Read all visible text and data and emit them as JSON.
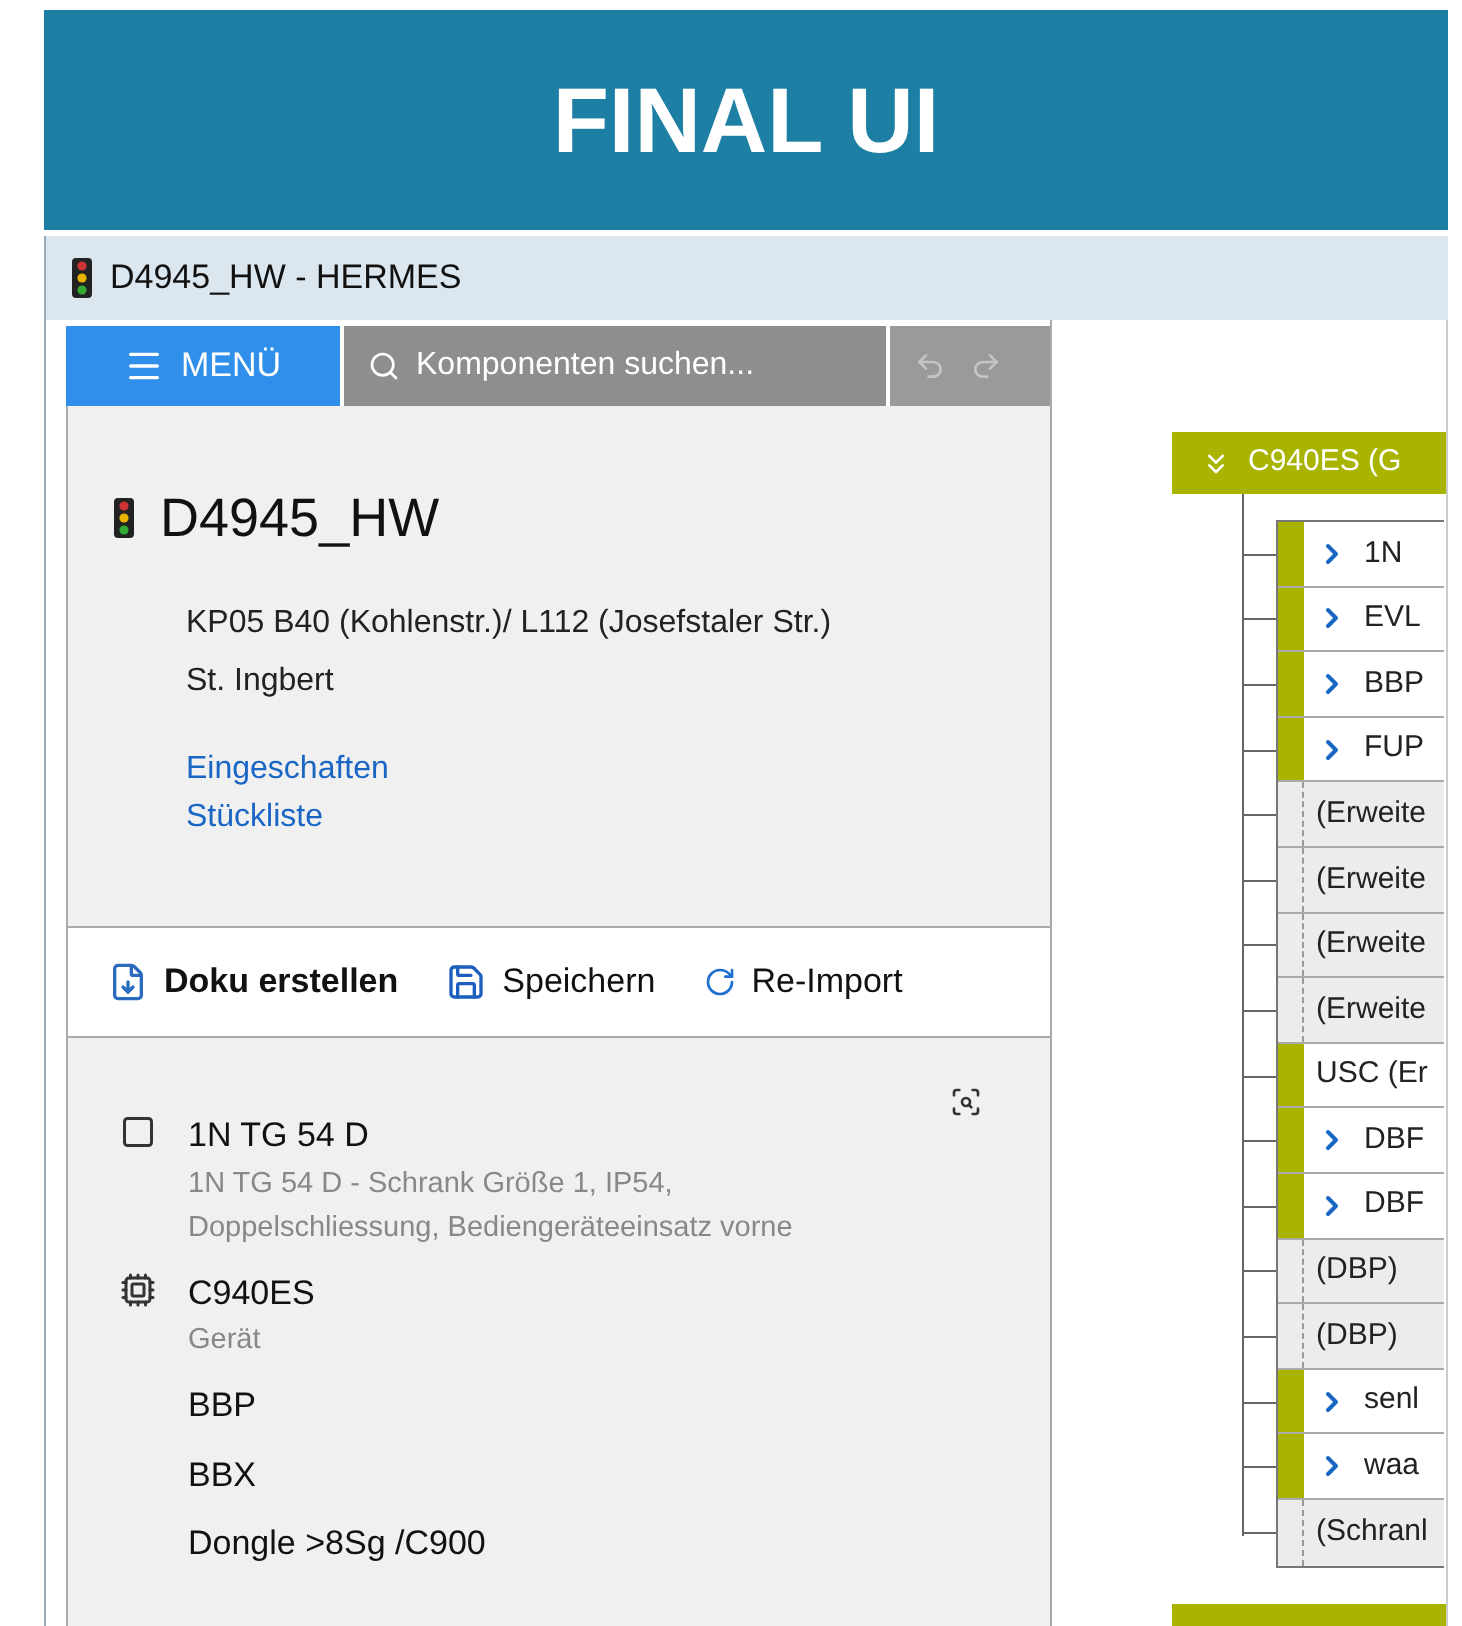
{
  "banner": {
    "title": "FINAL UI"
  },
  "window": {
    "title": "D4945_HW - HERMES"
  },
  "toolbar": {
    "menu": "MENÜ",
    "search": {
      "placeholder": "Komponenten suchen..."
    }
  },
  "details": {
    "title": "D4945_HW",
    "address": [
      "KP05 B40 (Kohlenstr.)/ L112 (Josefstaler Str.)",
      "St. Ingbert"
    ],
    "links": [
      "Eingeschaften",
      "Stückliste"
    ]
  },
  "actions": [
    {
      "kind": "doku",
      "label": "Doku erstellen"
    },
    {
      "kind": "save",
      "label": "Speichern"
    },
    {
      "kind": "reimport",
      "label": "Re-Import"
    }
  ],
  "components": [
    {
      "kind": "cabinet",
      "name": "1N TG 54 D",
      "description": "1N TG 54 D - Schrank Größe 1, IP54, Doppelschliessung, Bediengeräteeinsatz vorne"
    },
    {
      "kind": "device",
      "name": "C940ES",
      "description": "Gerät"
    },
    {
      "kind": "plain",
      "name": "BBP"
    },
    {
      "kind": "plain",
      "name": "BBX"
    },
    {
      "kind": "plain",
      "name": "Dongle >8Sg /C900"
    }
  ],
  "tree": {
    "header": "C940ES (G",
    "expanded": true,
    "rows": [
      {
        "label": "1N",
        "linked": true,
        "expandable": true
      },
      {
        "label": "EVL",
        "linked": true,
        "expandable": true
      },
      {
        "label": "BBP",
        "linked": true,
        "expandable": true
      },
      {
        "label": "FUP",
        "linked": true,
        "expandable": true
      },
      {
        "label": "(Erweite",
        "linked": false,
        "expandable": false
      },
      {
        "label": "(Erweite",
        "linked": false,
        "expandable": false
      },
      {
        "label": "(Erweite",
        "linked": false,
        "expandable": false
      },
      {
        "label": "(Erweite",
        "linked": false,
        "expandable": false
      },
      {
        "label": "USC (Er",
        "linked": true,
        "expandable": false
      },
      {
        "label": "DBF",
        "linked": true,
        "expandable": true
      },
      {
        "label": "DBF",
        "linked": true,
        "expandable": true
      },
      {
        "label": "(DBP)",
        "linked": false,
        "expandable": false
      },
      {
        "label": "(DBP)",
        "linked": false,
        "expandable": false
      },
      {
        "label": "senl",
        "linked": true,
        "expandable": true
      },
      {
        "label": "waa",
        "linked": true,
        "expandable": true
      },
      {
        "label": "(Schranl",
        "linked": false,
        "expandable": false
      }
    ]
  }
}
